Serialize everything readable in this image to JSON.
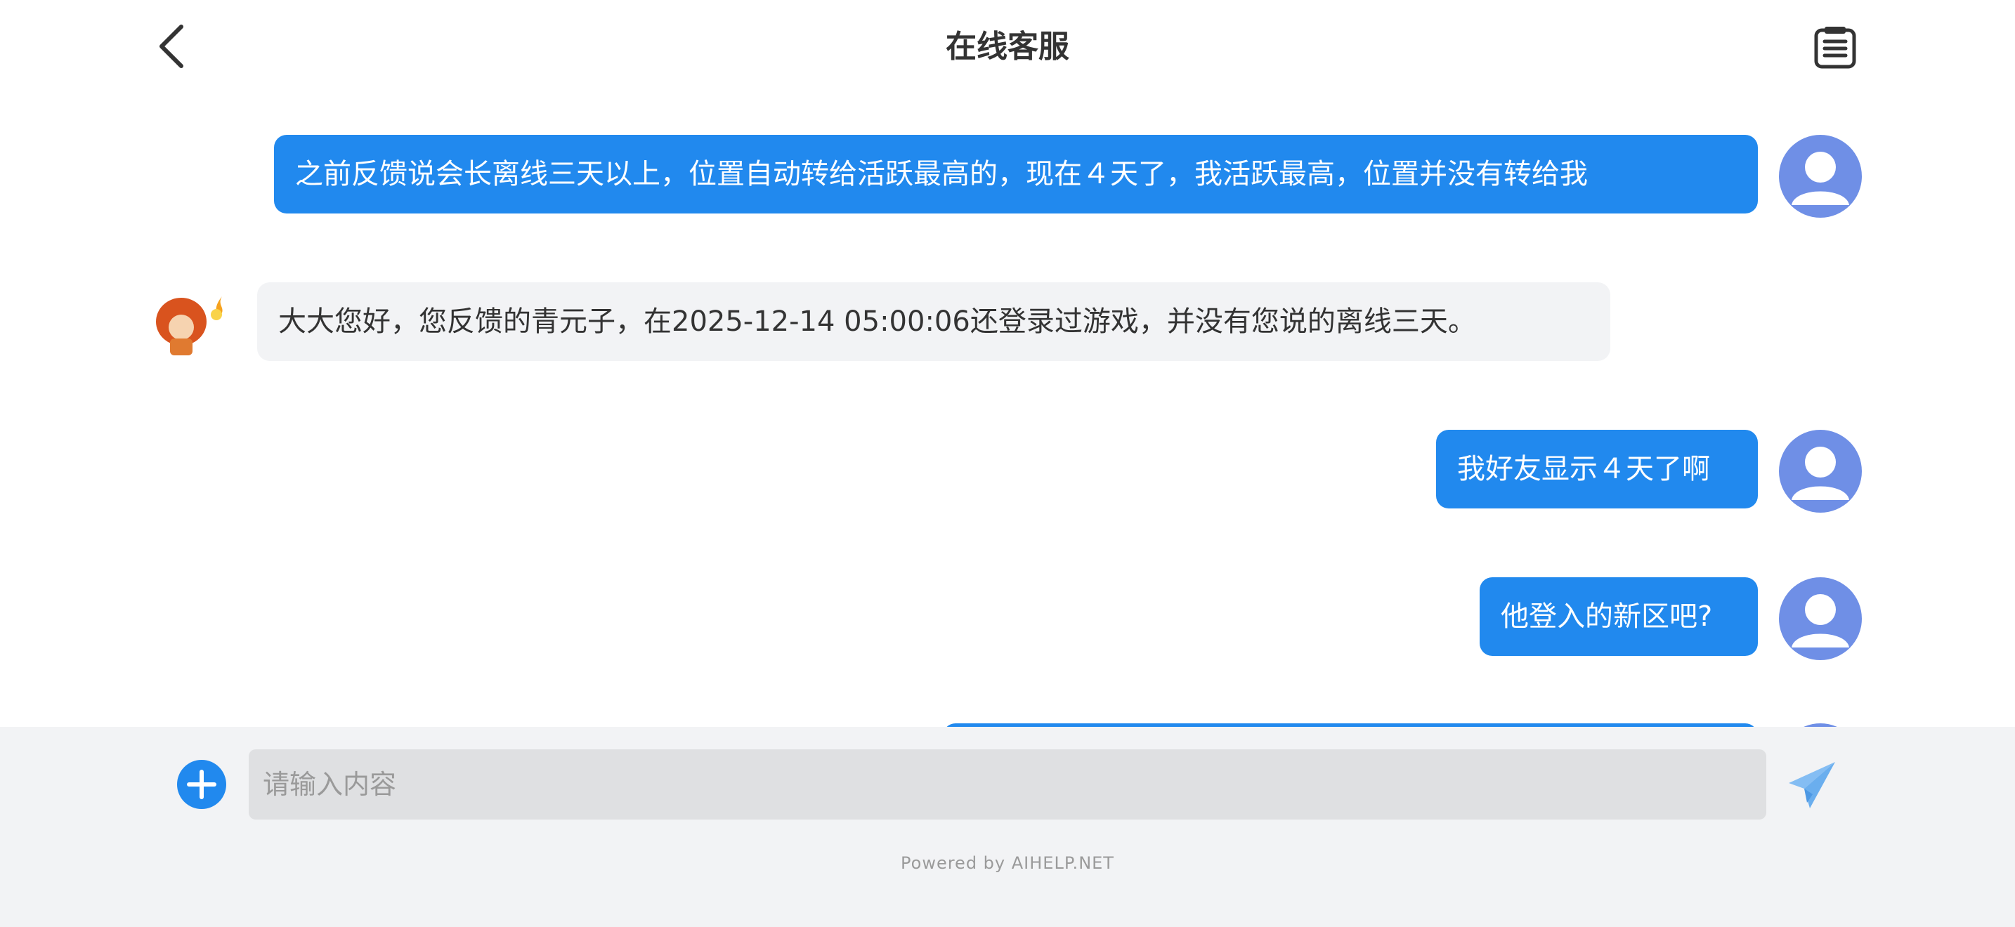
{
  "header": {
    "title": "在线客服",
    "back_icon": "chevron-left-icon",
    "history_icon": "clipboard-list-icon"
  },
  "messages": [
    {
      "sender": "user",
      "text": "之前反馈说会长离线三天以上，位置自动转给活跃最高的，现在４天了，我活跃最高，位置并没有转给我"
    },
    {
      "sender": "agent",
      "text": "大大您好，您反馈的青元子，在2025-12-14 05:00:06还登录过游戏，并没有您说的离线三天。"
    },
    {
      "sender": "user",
      "text": "我好友显示４天了啊"
    },
    {
      "sender": "user",
      "text": "他登入的新区吧?"
    }
  ],
  "input": {
    "placeholder": "请输入内容",
    "plus_icon": "plus-circle-icon",
    "send_icon": "paper-plane-icon"
  },
  "footer": {
    "powered_by": "Powered by AIHELP.NET"
  },
  "colors": {
    "user_bubble": "#2189ee",
    "agent_bubble": "#f2f3f5",
    "avatar": "#6f8fe6",
    "input_bar": "#f2f3f5",
    "send_icon": "#84bdf3"
  }
}
